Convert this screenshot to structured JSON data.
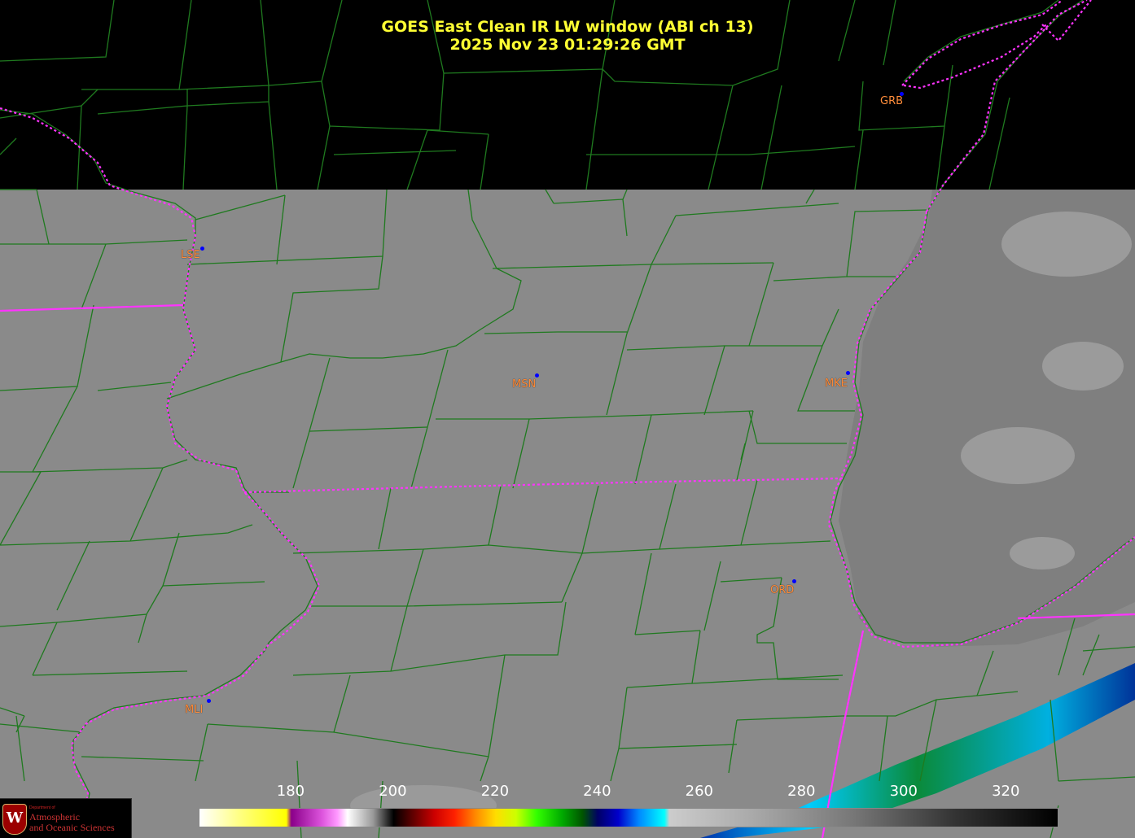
{
  "title": {
    "line1": "GOES East Clean IR LW window (ABI ch 13)",
    "line2": "2025 Nov 23  01:29:26 GMT"
  },
  "stations": [
    {
      "code": "GRB"
    },
    {
      "code": "LSE"
    },
    {
      "code": "MSN"
    },
    {
      "code": "MKE"
    },
    {
      "code": "ORD"
    },
    {
      "code": "MLI"
    }
  ],
  "colorbar": {
    "ticks": [
      "180",
      "200",
      "220",
      "240",
      "260",
      "280",
      "300",
      "320"
    ],
    "tick_values": [
      180,
      200,
      220,
      240,
      260,
      280,
      300,
      320
    ],
    "range": [
      162,
      330
    ]
  },
  "logo": {
    "department": "Department of",
    "line1": "Atmospheric",
    "line2": "and Oceanic Sciences",
    "crest_letter": "W"
  },
  "colors": {
    "title": "#ffff33",
    "county_lines": "#1f7a1f",
    "state_lines": "#ff33ff",
    "station_label": "#ff8c3a",
    "station_dot": "#0000ff",
    "land_cloud_gray": "#8a8a8a"
  }
}
